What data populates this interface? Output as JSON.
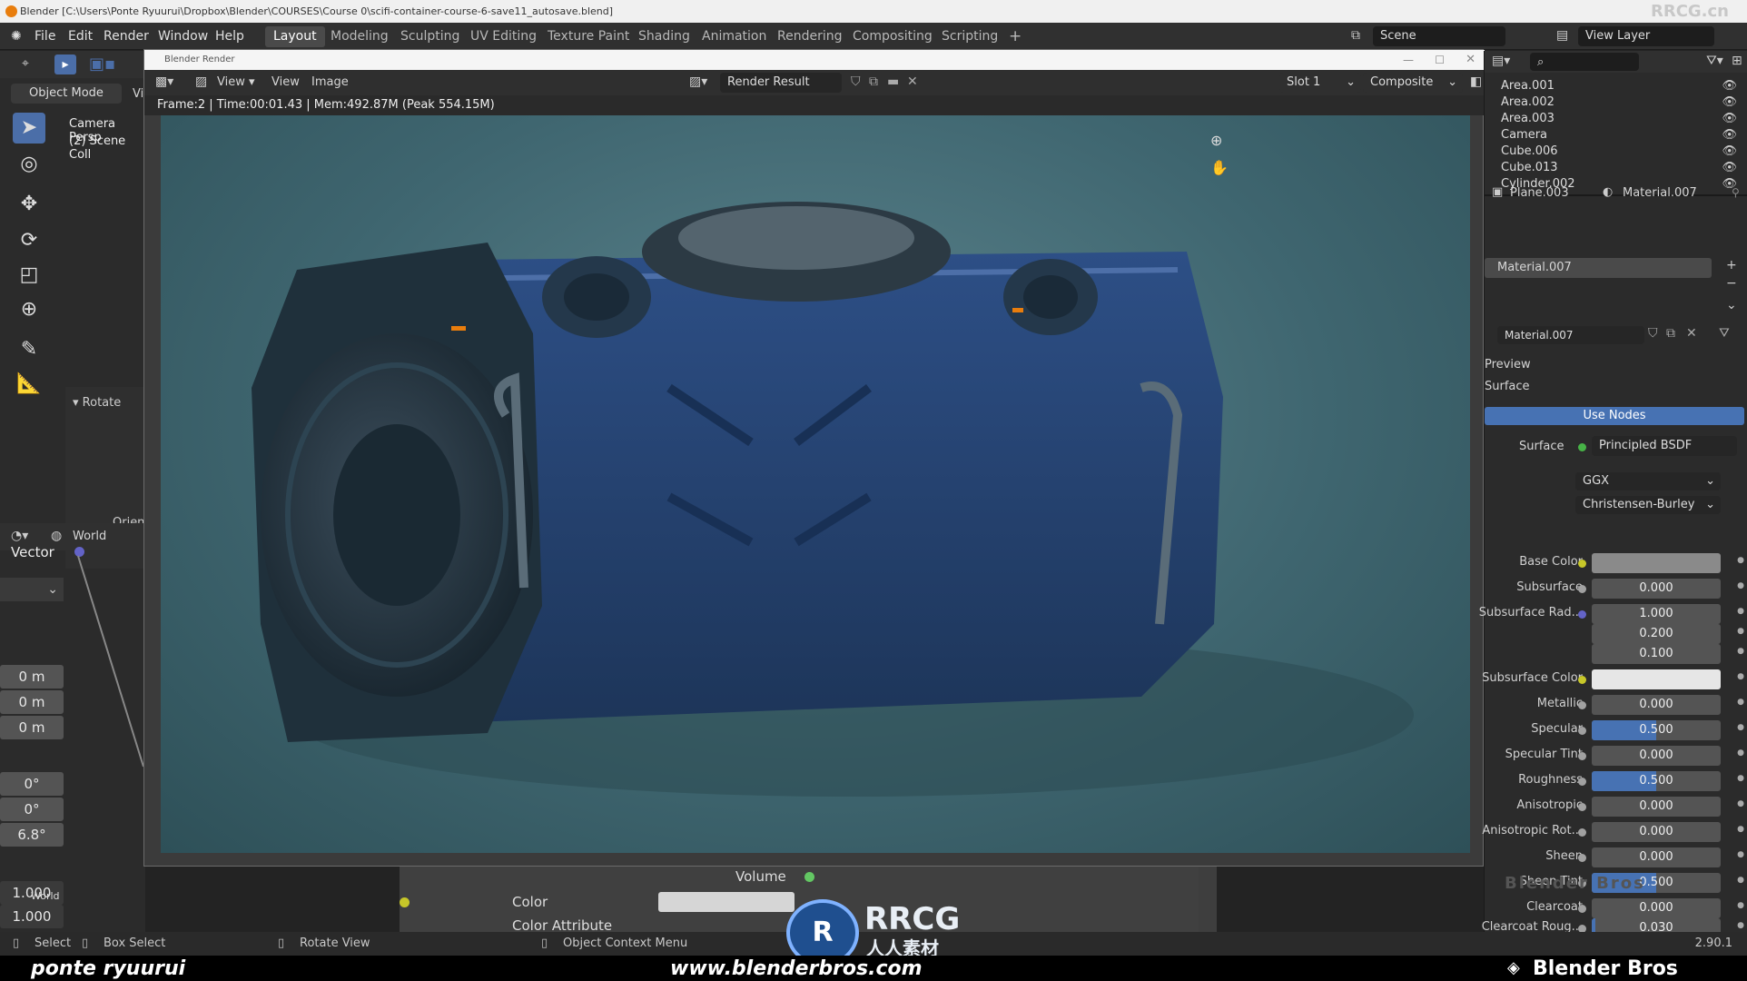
{
  "titlebar": {
    "path": "Blender [C:\\Users\\Ponte Ryuurui\\Dropbox\\Blender\\COURSES\\Course 0\\scifi-container-course-6-save11_autosave.blend]",
    "watermark": "RRCG.cn"
  },
  "menu": {
    "file": "File",
    "edit": "Edit",
    "render": "Render",
    "window": "Window",
    "help": "Help"
  },
  "workspaces": [
    "Layout",
    "Modeling",
    "Sculpting",
    "UV Editing",
    "Texture Paint",
    "Shading",
    "Animation",
    "Rendering",
    "Compositing",
    "Scripting"
  ],
  "topright": {
    "scene": "Scene",
    "view_layer": "View Layer"
  },
  "viewport": {
    "mode": "Object Mode",
    "view_short": "Vi",
    "overlay_line1": "Camera Persp",
    "overlay_line2": "(2) Scene Coll",
    "rotate_panel": "Rotate",
    "orient_label": "Orient",
    "world_label": "World",
    "vector_label": "Vector",
    "location_values": [
      "0 m",
      "0 m",
      "0 m"
    ],
    "rotation_values": [
      "0°",
      "0°",
      "6.8°"
    ],
    "scale_values": [
      "1.000",
      "1.000"
    ],
    "world_small": "World"
  },
  "render_window": {
    "title": "Blender Render",
    "menu_view": "View",
    "menu_view2": "View",
    "menu_image": "Image",
    "image_name": "Render Result",
    "slot": "Slot 1",
    "pass": "Composite",
    "stats": "Frame:2 | Time:00:01.43 | Mem:492.87M (Peak 554.15M)"
  },
  "outliner": [
    {
      "name": "Area.001"
    },
    {
      "name": "Area.002"
    },
    {
      "name": "Area.003"
    },
    {
      "name": "Camera"
    },
    {
      "name": "Cube.006"
    },
    {
      "name": "Cube.013"
    },
    {
      "name": "Cylinder.002"
    }
  ],
  "properties": {
    "object": "Plane.003",
    "material_header": "Material.007",
    "slot_material": "Material.007",
    "datablock": "Material.007",
    "preview": "Preview",
    "surface_panel": "Surface",
    "use_nodes": "Use Nodes",
    "surface_label": "Surface",
    "surface_shader": "Principled BSDF",
    "distribution": "GGX",
    "subsurface_method": "Christensen-Burley",
    "rows": [
      {
        "label": "Base Color",
        "value": "",
        "fill": 0
      },
      {
        "label": "Subsurface",
        "value": "0.000",
        "fill": 0
      },
      {
        "label": "Subsurface Rad...",
        "value": "1.000",
        "fill": 0
      },
      {
        "label": "",
        "value": "0.200",
        "fill": 0
      },
      {
        "label": "",
        "value": "0.100",
        "fill": 0
      },
      {
        "label": "Subsurface Color",
        "value": "",
        "fill": 0
      },
      {
        "label": "Metallic",
        "value": "0.000",
        "fill": 0
      },
      {
        "label": "Specular",
        "value": "0.500",
        "fill": 0.5
      },
      {
        "label": "Specular Tint",
        "value": "0.000",
        "fill": 0
      },
      {
        "label": "Roughness",
        "value": "0.500",
        "fill": 0.5
      },
      {
        "label": "Anisotropic",
        "value": "0.000",
        "fill": 0
      },
      {
        "label": "Anisotropic Rot...",
        "value": "0.000",
        "fill": 0
      },
      {
        "label": "Sheen",
        "value": "0.000",
        "fill": 0
      },
      {
        "label": "Sheen Tint",
        "value": "0.500",
        "fill": 0.5
      },
      {
        "label": "Clearcoat",
        "value": "0.000",
        "fill": 0
      },
      {
        "label": "Clearcoat Roug...",
        "value": "0.030",
        "fill": 0.03
      }
    ],
    "watermark": "Blender Bros"
  },
  "node_editor": {
    "volume": "Volume",
    "color": "Color",
    "color_attribute": "Color Attribute"
  },
  "statusbar": {
    "select": "Select",
    "box_select": "Box Select",
    "rotate_view": "Rotate View",
    "context_menu": "Object Context Menu",
    "version": "2.90.1"
  },
  "brandbar": {
    "left": "ponte ryuurui",
    "center": "www.blenderbros.com",
    "right": "Blender Bros"
  },
  "watermarks": {
    "rrcg": "RRCG",
    "rrcg_cn": "人人素材"
  },
  "colors": {
    "accent": "#4772b3",
    "orange": "#e87d0d"
  }
}
